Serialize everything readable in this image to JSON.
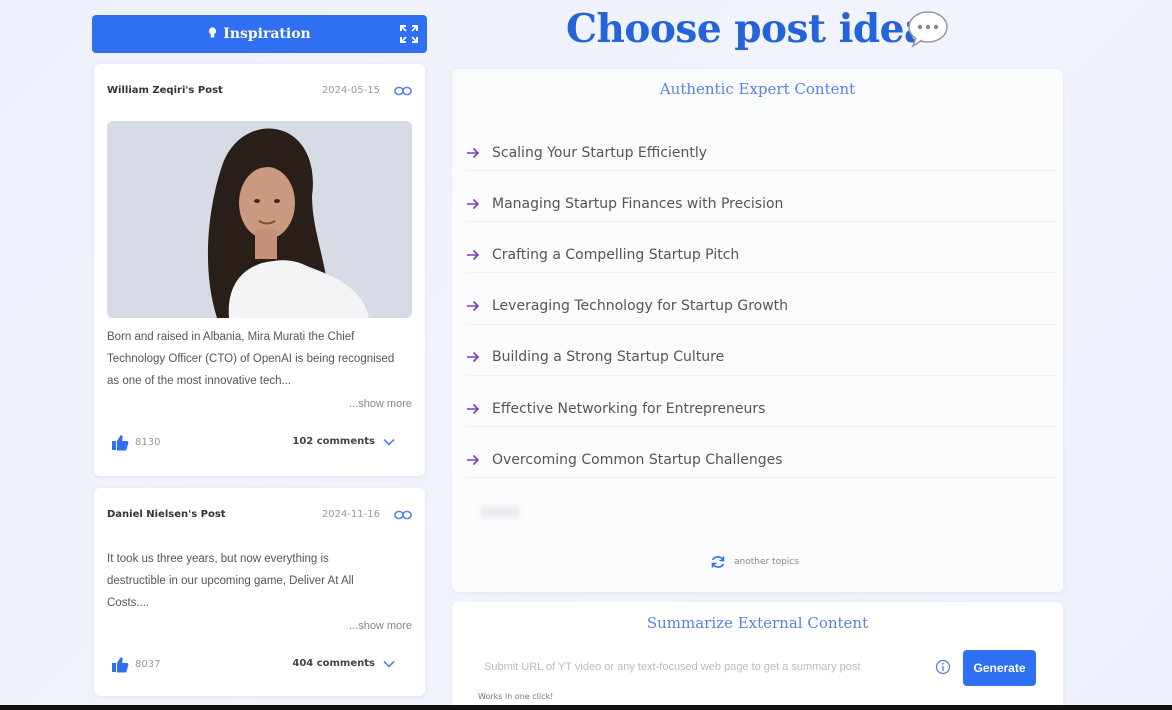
{
  "inspiration": {
    "label": "Inspiration",
    "icon": "bulb-icon",
    "expand_icon": "expand-icon"
  },
  "posts": [
    {
      "author": "William Zeqiri's Post",
      "date": "2024-05-15",
      "text": "Born and raised in Albania, Mira Murati the Chief Technology Officer (CTO) of OpenAI is being recognised as one of the most innovative tech...",
      "show_more": "...show more",
      "likes": "8130",
      "comments": "102 comments"
    },
    {
      "author": "Daniel Nielsen's Post",
      "date": "2024-11-16",
      "text": "It took us three years, but now everything is destructible in our upcoming game, Deliver At All Costs....",
      "show_more": "...show more",
      "likes": "8037",
      "comments": "404 comments"
    }
  ],
  "header": {
    "title": "Choose post idea",
    "icon": "speech-bubble-icon"
  },
  "topics_panel": {
    "title": "Authentic Expert Content",
    "topics": [
      "Scaling Your Startup Efficiently",
      "Managing Startup Finances with Precision",
      "Crafting a Compelling Startup Pitch",
      "Leveraging Technology for Startup Growth",
      "Building a Strong Startup Culture",
      "Effective Networking for Entrepreneurs",
      "Overcoming Common Startup Challenges"
    ],
    "another_label": "another topics"
  },
  "summarize": {
    "title": "Summarize External Content",
    "placeholder": "Submit URL of YT video or any text-focused web page to get a summary post",
    "button_label": "Generate",
    "hint": "Works in one click!"
  },
  "colors": {
    "accent": "#2f6ff2",
    "title": "#2563d8",
    "arrow": "#7b3fb8",
    "panel_title": "#5b82e0"
  }
}
